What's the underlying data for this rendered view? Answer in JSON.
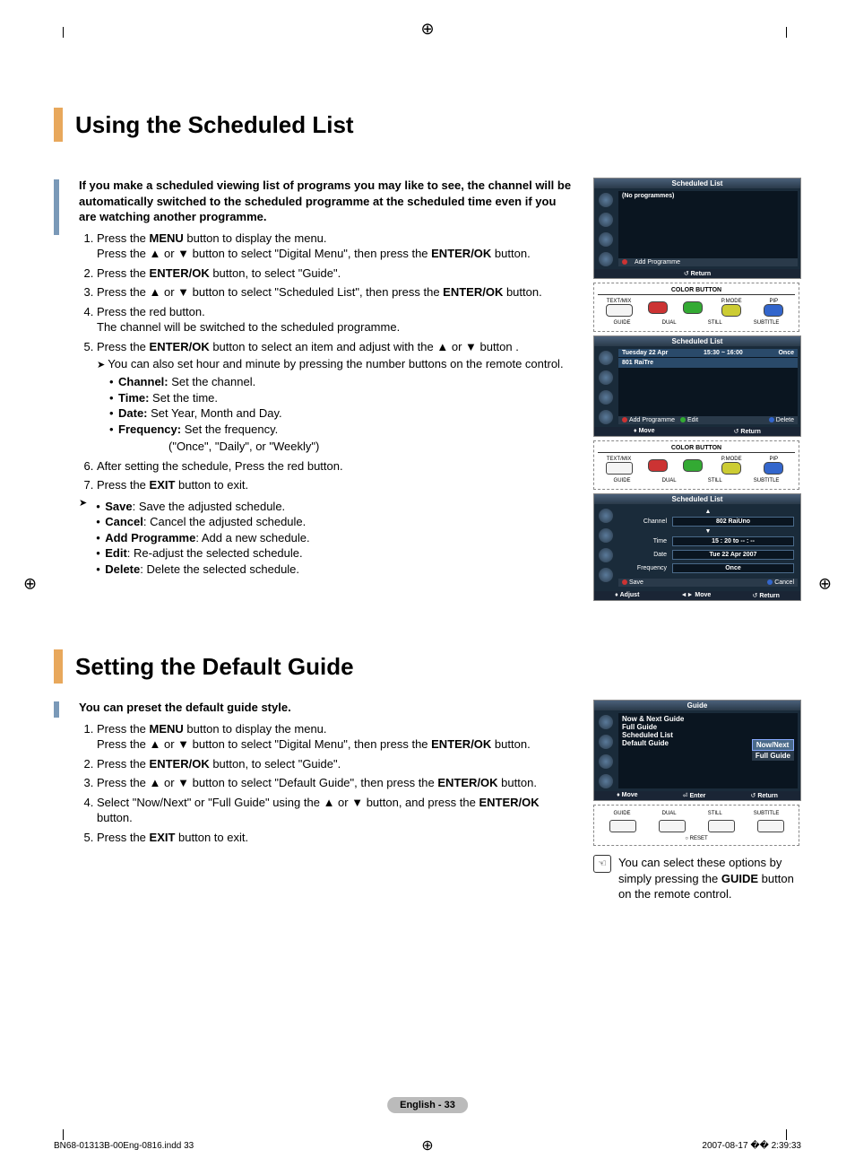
{
  "section1": {
    "title": "Using the Scheduled List",
    "intro": "If you make a scheduled viewing list of programs you may like to see, the channel will be automatically switched to the scheduled programme at the scheduled time even if you are watching another programme.",
    "steps": {
      "s1a": "Press the ",
      "s1b": "MENU",
      "s1c": " button to display the menu.",
      "s1d": "Press the ▲ or ▼ button to select \"Digital Menu\", then press the ",
      "s1e": "ENTER/OK",
      "s1f": " button.",
      "s2a": "Press the ",
      "s2b": "ENTER/OK",
      "s2c": " button, to select \"Guide\".",
      "s3a": "Press the ▲ or ▼ button to select \"Scheduled List\", then press the ",
      "s3b": "ENTER/OK",
      "s3c": " button.",
      "s4a": "Press the red button.",
      "s4b": "The channel will be switched to the scheduled programme.",
      "s5a": "Press the ",
      "s5b": "ENTER/OK",
      "s5c": " button to select an item and adjust with the ▲ or ▼ button .",
      "s5note": "You can also set hour and minute by pressing the number buttons on the remote control.",
      "s5bul1a": "Channel:",
      "s5bul1b": " Set the channel.",
      "s5bul2a": "Time:",
      "s5bul2b": " Set the time.",
      "s5bul3a": "Date:",
      "s5bul3b": " Set Year, Month and Day.",
      "s5bul4a": "Frequency:",
      "s5bul4b": " Set the frequency.",
      "s5bul4c": "(\"Once\", \"Daily\", or \"Weekly\")",
      "s6": "After setting the schedule, Press the red button.",
      "s7a": "Press the ",
      "s7b": "EXIT",
      "s7c": " button to exit."
    },
    "actions": {
      "a1a": "Save",
      "a1b": ": Save the adjusted schedule.",
      "a2a": "Cancel",
      "a2b": ": Cancel the adjusted schedule.",
      "a3a": "Add Programme",
      "a3b": ": Add a new schedule.",
      "a4a": "Edit",
      "a4b": ": Re-adjust the selected schedule.",
      "a5a": "Delete",
      "a5b": ": Delete the selected schedule."
    }
  },
  "tv1": {
    "title": "Scheduled List",
    "noprog": "(No programmes)",
    "add": "Add Programme",
    "return": "Return"
  },
  "remote1": {
    "title": "COLOR BUTTON",
    "textmix": "TEXT/MIX",
    "pmode": "P.MODE",
    "pip": "PIP",
    "guide": "GUIDE",
    "dual": "DUAL",
    "still": "STILL",
    "subtitle": "SUBTITLE"
  },
  "tv2": {
    "title": "Scheduled List",
    "date": "Tuesday  22  Apr",
    "time": "15:30 ~ 16:00",
    "once": "Once",
    "ch": "801  RaiTre",
    "add": "Add Programme",
    "edit": "Edit",
    "delete": "Delete",
    "move": "Move",
    "return": "Return"
  },
  "tv3": {
    "title": "Scheduled List",
    "channel_lbl": "Channel",
    "channel_val": "802 RaiUno",
    "time_lbl": "Time",
    "time_val": "15 : 20 to -- : --",
    "date_lbl": "Date",
    "date_val": "Tue 22 Apr 2007",
    "freq_lbl": "Frequency",
    "freq_val": "Once",
    "save": "Save",
    "cancel": "Cancel",
    "adjust": "Adjust",
    "move": "Move",
    "return": "Return"
  },
  "section2": {
    "title": "Setting the Default Guide",
    "intro": "You can preset the default guide style.",
    "s1a": "Press the ",
    "s1b": "MENU",
    "s1c": " button to display the menu.",
    "s1d": "Press the ▲ or ▼ button to select \"Digital Menu\", then press the ",
    "s1e": "ENTER/OK",
    "s1f": " button.",
    "s2a": "Press the ",
    "s2b": "ENTER/OK",
    "s2c": " button, to select \"Guide\".",
    "s3a": "Press the ▲ or ▼ button to select \"Default Guide\", then press the ",
    "s3b": "ENTER/OK",
    "s3c": " button.",
    "s4a": "Select \"Now/Next\" or \"Full Guide\" using the ▲ or ▼ button, and press the ",
    "s4b": "ENTER/OK",
    "s4c": " button.",
    "s5a": "Press the ",
    "s5b": "EXIT",
    "s5c": " button to exit."
  },
  "tv4": {
    "title": "Guide",
    "i1": "Now & Next Guide",
    "i2": "Full Guide",
    "i3": "Scheduled List",
    "i4": "Default Guide",
    "opt1": "Now/Next",
    "opt2": "Full Guide",
    "move": "Move",
    "enter": "Enter",
    "return": "Return"
  },
  "remote2": {
    "guide": "GUIDE",
    "dual": "DUAL",
    "still": "STILL",
    "subtitle": "SUBTITLE",
    "reset": "RESET"
  },
  "note2": {
    "text1": "You can select these options by simply pressing the ",
    "text2": "GUIDE",
    "text3": " button on the remote control."
  },
  "footer": {
    "pagenum": "English - 33",
    "indd": "BN68-01313B-00Eng-0816.indd   33",
    "time": "2007-08-17   �� 2:39:33"
  }
}
